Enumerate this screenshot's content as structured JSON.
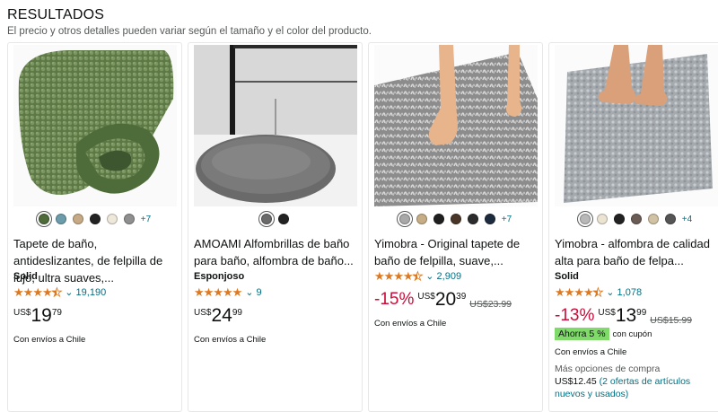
{
  "header": {
    "title": "RESULTADOS",
    "subtitle": "El precio y otros detalles pueden variar según el tamaño y el color del producto."
  },
  "products": [
    {
      "title": "Tapete de baño, antideslizantes, de felpilla de lujo, ultra suaves,...",
      "subtitle": "Solid",
      "rating": 4.5,
      "reviews": "19,190",
      "discount": "",
      "currency": "US$",
      "price_whole": "19",
      "price_fraction": "79",
      "old_price": "",
      "shipping": "Con envíos a Chile",
      "swatches": [
        "#4e6b3a",
        "#6c9cab",
        "#c7a985",
        "#222222",
        "#eee8da",
        "#8f8f8f"
      ],
      "more_colors": "+7"
    },
    {
      "title": "AMOAMI Alfombrillas de baño para baño, alfombra de baño...",
      "subtitle": "Esponjoso",
      "rating": 5,
      "reviews": "9",
      "discount": "",
      "currency": "US$",
      "price_whole": "24",
      "price_fraction": "99",
      "old_price": "",
      "shipping": "Con envíos a Chile",
      "swatches": [
        "#6a6a6a",
        "#222222"
      ],
      "more_colors": ""
    },
    {
      "title": "Yimobra - Original tapete de baño de felpilla, suave,...",
      "subtitle": "",
      "rating": 4.5,
      "reviews": "2,909",
      "discount": "-15%",
      "currency": "US$",
      "price_whole": "20",
      "price_fraction": "39",
      "old_price": "US$23.99",
      "shipping": "Con envíos a Chile",
      "swatches": [
        "#a8a8a8",
        "#c6ad86",
        "#1f1f1f",
        "#4a3628",
        "#2b2b2b",
        "#1c2b3d"
      ],
      "more_colors": "+7"
    },
    {
      "title": "Yimobra - alfombra de calidad alta para baño de felpa...",
      "subtitle": "Solid",
      "rating": 4.5,
      "reviews": "1,078",
      "discount": "-13%",
      "currency": "US$",
      "price_whole": "13",
      "price_fraction": "99",
      "old_price": "US$15.99",
      "savings_badge": "Ahorra 5 %",
      "savings_note": "con cupón",
      "shipping": "Con envíos a Chile",
      "more_buying": "Más opciones de compra",
      "alt_price": "US$12.45",
      "alt_offers": "(2 ofertas de artículos nuevos y usados)",
      "swatches": [
        "#b8b8b8",
        "#ece4d2",
        "#222222",
        "#6b5b55",
        "#d0c2a3",
        "#555555"
      ],
      "more_colors": "+4"
    }
  ],
  "colors": {
    "link": "#007185",
    "star": "#de7921",
    "discount": "#cc0c39",
    "badge": "#7fda69"
  }
}
